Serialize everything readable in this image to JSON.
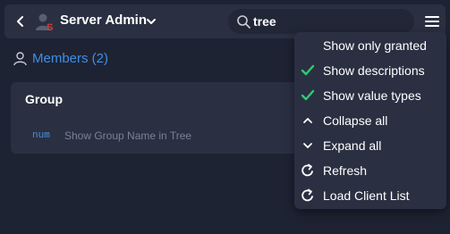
{
  "header": {
    "title": "Server Admin",
    "search_value": "tree"
  },
  "members": {
    "label": "Members (2)"
  },
  "group": {
    "title": "Group",
    "item_type": "num",
    "item_description": "Show Group Name in Tree"
  },
  "menu": {
    "items": [
      {
        "label": "Show only granted",
        "icon": "none"
      },
      {
        "label": "Show descriptions",
        "icon": "check-icon",
        "checked": true
      },
      {
        "label": "Show value types",
        "icon": "check-icon",
        "checked": true
      },
      {
        "label": "Collapse all",
        "icon": "chevron-up-icon"
      },
      {
        "label": "Expand all",
        "icon": "chevron-down-icon"
      },
      {
        "label": "Refresh",
        "icon": "refresh-icon"
      },
      {
        "label": "Load Client List",
        "icon": "refresh-icon"
      }
    ]
  },
  "colors": {
    "background": "#1e2333",
    "panel": "#2a3042",
    "accent": "#3d8fe6",
    "check": "#2ecc71"
  }
}
